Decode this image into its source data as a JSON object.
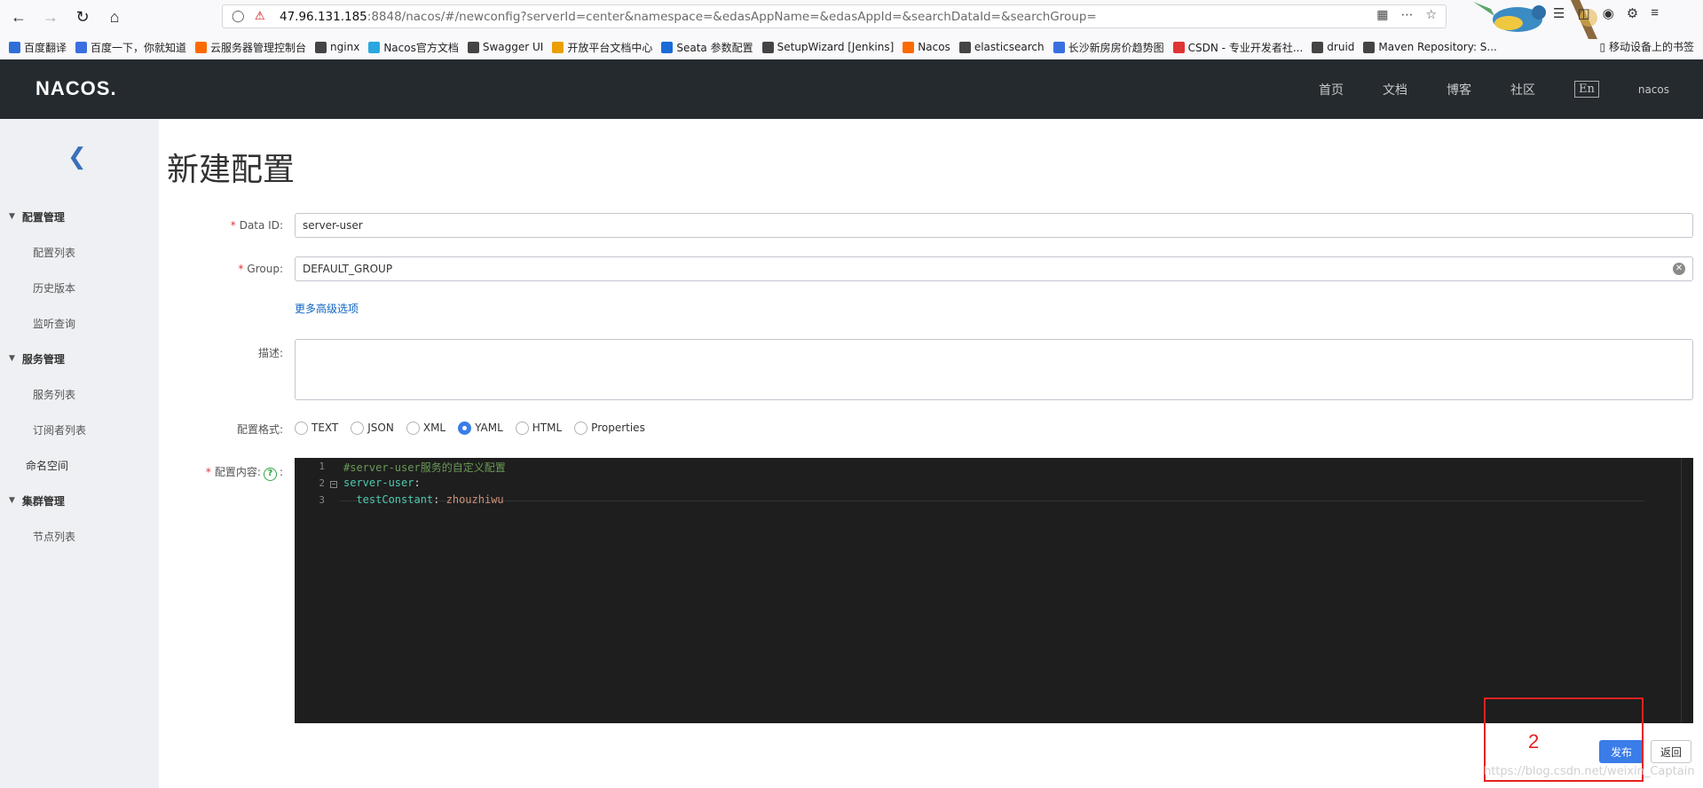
{
  "browser": {
    "url_host": "47.96.131.185",
    "url_rest": ":8848/nacos/#/newconfig?serverId=center&namespace=&edasAppName=&edasAppId=&searchDataId=&searchGroup="
  },
  "bookmarks": [
    {
      "label": "百度翻译",
      "color": "#2f6fd8",
      "icon": "translate-icon"
    },
    {
      "label": "百度一下，你就知道",
      "color": "#3a6fe0",
      "icon": "paw-icon"
    },
    {
      "label": "云服务器管理控制台",
      "color": "#ff6a00",
      "icon": "aliyun-icon"
    },
    {
      "label": "nginx",
      "color": "#444",
      "icon": "globe-icon"
    },
    {
      "label": "Nacos官方文档",
      "color": "#2aa7e0",
      "icon": "nacos-icon"
    },
    {
      "label": "Swagger UI",
      "color": "#444",
      "icon": "globe-icon"
    },
    {
      "label": "开放平台文档中心",
      "color": "#e9a000",
      "icon": "figure-icon"
    },
    {
      "label": "Seata 参数配置",
      "color": "#1a6bd8",
      "icon": "seata-icon"
    },
    {
      "label": "SetupWizard [Jenkins]",
      "color": "#444",
      "icon": "globe-icon"
    },
    {
      "label": "Nacos",
      "color": "#ff6a00",
      "icon": "aliyun-icon"
    },
    {
      "label": "elasticsearch",
      "color": "#444",
      "icon": "globe-icon"
    },
    {
      "label": "长沙新房房价趋势图",
      "color": "#3a6fe0",
      "icon": "paw-icon"
    },
    {
      "label": "CSDN - 专业开发者社...",
      "color": "#e03333",
      "icon": "csdn-icon"
    },
    {
      "label": "druid",
      "color": "#444",
      "icon": "globe-icon"
    },
    {
      "label": "Maven Repository: S...",
      "color": "#444",
      "icon": "globe-icon"
    }
  ],
  "bookmarks_right": "移动设备上的书签",
  "header": {
    "logo": "NACOS.",
    "nav": [
      "首页",
      "文档",
      "博客",
      "社区"
    ],
    "lang": "En",
    "user": "nacos"
  },
  "sidebar": {
    "items": [
      {
        "label": "配置管理",
        "type": "group"
      },
      {
        "label": "配置列表",
        "type": "sub"
      },
      {
        "label": "历史版本",
        "type": "sub"
      },
      {
        "label": "监听查询",
        "type": "sub"
      },
      {
        "label": "服务管理",
        "type": "group"
      },
      {
        "label": "服务列表",
        "type": "sub"
      },
      {
        "label": "订阅者列表",
        "type": "sub"
      },
      {
        "label": "命名空间",
        "type": "plain"
      },
      {
        "label": "集群管理",
        "type": "group"
      },
      {
        "label": "节点列表",
        "type": "sub"
      }
    ]
  },
  "form": {
    "title": "新建配置",
    "data_id_label": "Data ID:",
    "data_id_value": "server-user",
    "group_label": "Group:",
    "group_value": "DEFAULT_GROUP",
    "advanced_link": "更多高级选项",
    "desc_label": "描述:",
    "format_label": "配置格式:",
    "formats": [
      {
        "label": "TEXT",
        "checked": false
      },
      {
        "label": "JSON",
        "checked": false
      },
      {
        "label": "XML",
        "checked": false
      },
      {
        "label": "YAML",
        "checked": true
      },
      {
        "label": "HTML",
        "checked": false
      },
      {
        "label": "Properties",
        "checked": false
      }
    ],
    "content_label": "配置内容:",
    "help_symbol": "?",
    "colon": ":",
    "code": {
      "line_numbers": [
        "1",
        "2",
        "3"
      ],
      "line1": "#server-user服务的自定义配置",
      "line2_key": "server-user",
      "line3_key": "testConstant",
      "line3_value": "zhouzhiwu",
      "colon": ":"
    },
    "publish": "发布",
    "back": "返回"
  },
  "annotation": {
    "number": "2",
    "color": "#e52020"
  },
  "watermark": "https://blog.csdn.net/weixin_Captain"
}
